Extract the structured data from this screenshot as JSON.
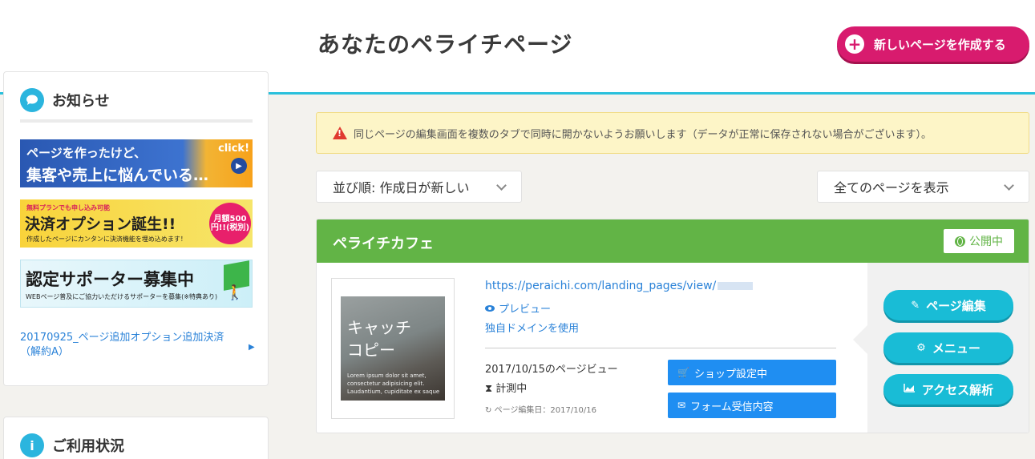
{
  "header": {
    "page_title": "あなたのペライチページ",
    "new_page_button": "新しいページを作成する"
  },
  "sidebar": {
    "news": {
      "title": "お知らせ",
      "banners": [
        {
          "line1": "ページを作ったけど、",
          "line2": "集客や売上に悩んでいる…",
          "badge": "click!"
        },
        {
          "top": "無料プランでも申し込み可能",
          "line1": "決済オプション誕生!!",
          "line2": "作成したページにカンタンに決済機能を埋め込めます！",
          "price": "月額500円!!(税別)"
        },
        {
          "line1": "認定サポーター募集中",
          "line2": "WEBページ普及にご協力いただけるサポーターを募集(※特典あり)"
        }
      ],
      "link": "20170925_ページ追加オプション追加決済（解約A）"
    },
    "usage": {
      "title": "ご利用状況"
    }
  },
  "notice": {
    "text": "同じページの編集画面を複数のタブで同時に開かないようお願いします（データが正常に保存されない場合がございます）。"
  },
  "filters": {
    "sort_value": "並び順: 作成日が新しい",
    "filter_value": "全てのページを表示"
  },
  "page_card": {
    "title": "ペライチカフェ",
    "status": "公開中",
    "status_color": "#62b446",
    "thumbnail": {
      "catch": "キャッチ\nコピー",
      "lorem": "Lorem ipsum dolor sit amet, consectetur adipisicing elit. Laudantium, cupiditate ex saque"
    },
    "url": "https://peraichi.com/landing_pages/view/",
    "preview": "プレビュー",
    "domain_link": "独自ドメインを使用",
    "page_views": "2017/10/15のページビュー",
    "measuring": "計測中",
    "edit_date": "ページ編集日：2017/10/16",
    "shop_button": "ショップ設定中",
    "form_button": "フォーム受信内容",
    "actions": {
      "edit": "ページ編集",
      "menu": "メニュー",
      "access": "アクセス解析"
    }
  }
}
